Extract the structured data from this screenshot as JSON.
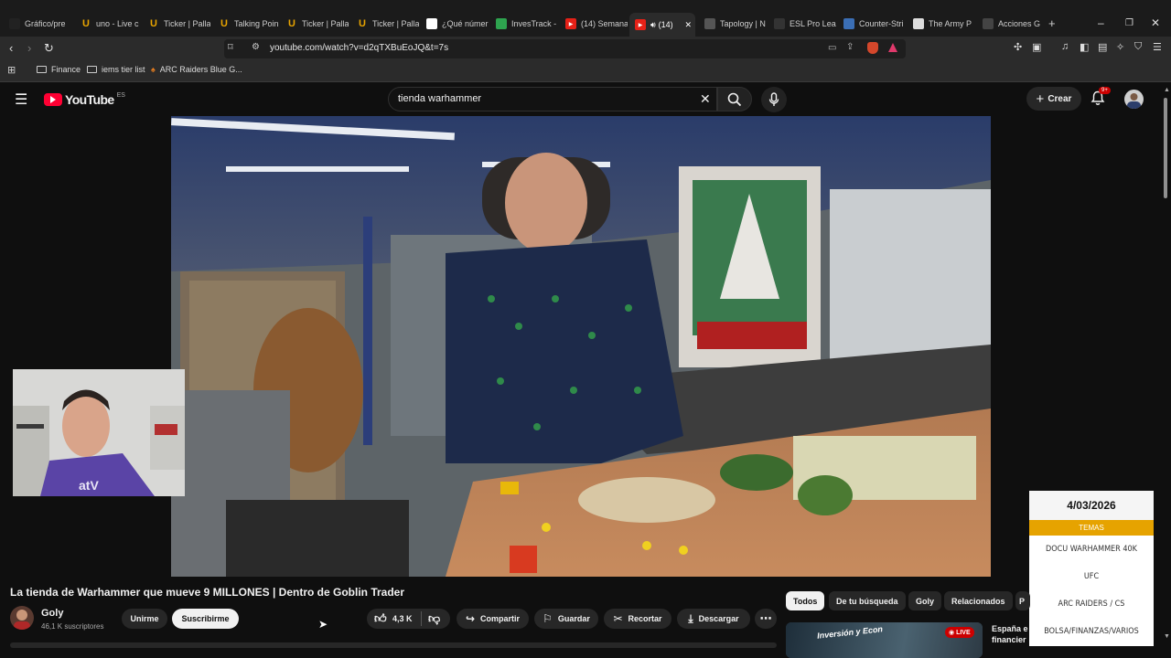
{
  "browser": {
    "tabs": [
      {
        "label": "Gráfico/pre",
        "icon": "tradingview-icon",
        "color": "#222"
      },
      {
        "label": "uno - Live c",
        "icon": "u-icon",
        "color": "#e8a400"
      },
      {
        "label": "Ticker | Palla",
        "icon": "u-icon",
        "color": "#e8a400"
      },
      {
        "label": "Talking Poin",
        "icon": "u-icon",
        "color": "#e8a400"
      },
      {
        "label": "Ticker | Palla",
        "icon": "u-icon",
        "color": "#e8a400"
      },
      {
        "label": "Ticker | Palla",
        "icon": "u-icon",
        "color": "#e8a400"
      },
      {
        "label": "¿Qué númer",
        "icon": "chat-icon",
        "color": "#fff"
      },
      {
        "label": "InvesTrack -",
        "icon": "check-icon",
        "color": "#2ea44f"
      },
      {
        "label": "(14) Semana",
        "icon": "youtube-icon",
        "color": "#e62117"
      },
      {
        "label": "(14)",
        "icon": "youtube-icon",
        "color": "#e62117"
      },
      {
        "label": "Tapology | N",
        "icon": "tapology-icon",
        "color": "#555"
      },
      {
        "label": "ESL Pro Lea",
        "icon": "esl-icon",
        "color": "#333"
      },
      {
        "label": "Counter-Stri",
        "icon": "liquipedia-icon",
        "color": "#3b6fb6"
      },
      {
        "label": "The Army P",
        "icon": "army-icon",
        "color": "#ddd"
      },
      {
        "label": "Acciones G",
        "icon": "investing-icon",
        "color": "#444"
      }
    ],
    "new_tab": "+",
    "url": "youtube.com/watch?v=d2qTXBuEoJQ&t=7s",
    "bookmarks": [
      {
        "label": "Finance"
      },
      {
        "label": "iems tier list"
      },
      {
        "label": "ARC Raiders Blue G..."
      }
    ]
  },
  "youtube": {
    "logo_text": "YouTube",
    "region": "ES",
    "search_value": "tienda warhammer",
    "create_label": "Crear",
    "notif_count": "9+"
  },
  "video": {
    "title": "La tienda de Warhammer que mueve 9 MILLONES | Dentro de Goblin Trader",
    "channel": "Goly",
    "subscribers": "46,1 K suscriptores",
    "join_label": "Unirme",
    "subscribe_label": "Suscribirme",
    "likes": "4,3 K",
    "share_label": "Compartir",
    "save_label": "Guardar",
    "clip_label": "Recortar",
    "download_label": "Descargar"
  },
  "chips": [
    "Todos",
    "De tu búsqueda",
    "Goly",
    "Relacionados",
    "P"
  ],
  "recommendation": {
    "title_line1": "España e",
    "title_line2": "financier",
    "thumb_text": "Inversión y Econ",
    "live_label": "LIVE"
  },
  "stream_overlay": {
    "date": "4/03/2026",
    "section_label": "TEMAS",
    "topics": [
      "DOCU WARHAMMER 40K",
      "UFC",
      "ARC RAIDERS / CS",
      "BOLSA/FINANZAS/VARIOS"
    ]
  }
}
